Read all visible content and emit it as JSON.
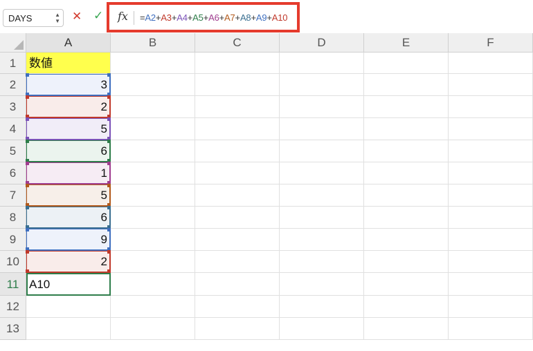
{
  "formula_bar": {
    "name_box": "DAYS",
    "cancel_icon": "✕",
    "enter_icon": "✓",
    "fx_label": "fx",
    "formula_parts": [
      {
        "text": "=",
        "color": "#333333"
      },
      {
        "text": "A2",
        "color": "#3f6fbf"
      },
      {
        "text": "+",
        "color": "#333333"
      },
      {
        "text": "A3",
        "color": "#c0392b"
      },
      {
        "text": "+",
        "color": "#333333"
      },
      {
        "text": "A4",
        "color": "#7b52b8"
      },
      {
        "text": "+",
        "color": "#333333"
      },
      {
        "text": "A5",
        "color": "#2e7d4a"
      },
      {
        "text": "+",
        "color": "#333333"
      },
      {
        "text": "A6",
        "color": "#a03d8f"
      },
      {
        "text": "+",
        "color": "#333333"
      },
      {
        "text": "A7",
        "color": "#b25a1c"
      },
      {
        "text": "+",
        "color": "#333333"
      },
      {
        "text": "A8",
        "color": "#3a6f91"
      },
      {
        "text": "+",
        "color": "#333333"
      },
      {
        "text": "A9",
        "color": "#3f6fbf"
      },
      {
        "text": "+",
        "color": "#333333"
      },
      {
        "text": "A10",
        "color": "#c0392b"
      }
    ]
  },
  "columns": [
    "A",
    "B",
    "C",
    "D",
    "E",
    "F"
  ],
  "rows": [
    "1",
    "2",
    "3",
    "4",
    "5",
    "6",
    "7",
    "8",
    "9",
    "10",
    "11",
    "12",
    "13"
  ],
  "cells": {
    "A1": "数値",
    "A_values": [
      "3",
      "2",
      "5",
      "6",
      "1",
      "5",
      "6",
      "9",
      "2"
    ],
    "A11": "A10"
  },
  "colors": {
    "header_fill": "#ffff4d",
    "highlight": "#e53b2d",
    "active_border": "#2e7d4a",
    "ref_colors": [
      "#3f6fbf",
      "#c0392b",
      "#7b52b8",
      "#2e7d4a",
      "#a03d8f",
      "#b25a1c",
      "#3a6f91",
      "#3f6fbf",
      "#c0392b"
    ],
    "ref_fills": [
      "#eef2fb",
      "#f9ecea",
      "#f1edf8",
      "#ebf4ee",
      "#f6ecf4",
      "#f7efe9",
      "#ecf1f5",
      "#eef2fb",
      "#f9ecea"
    ]
  }
}
